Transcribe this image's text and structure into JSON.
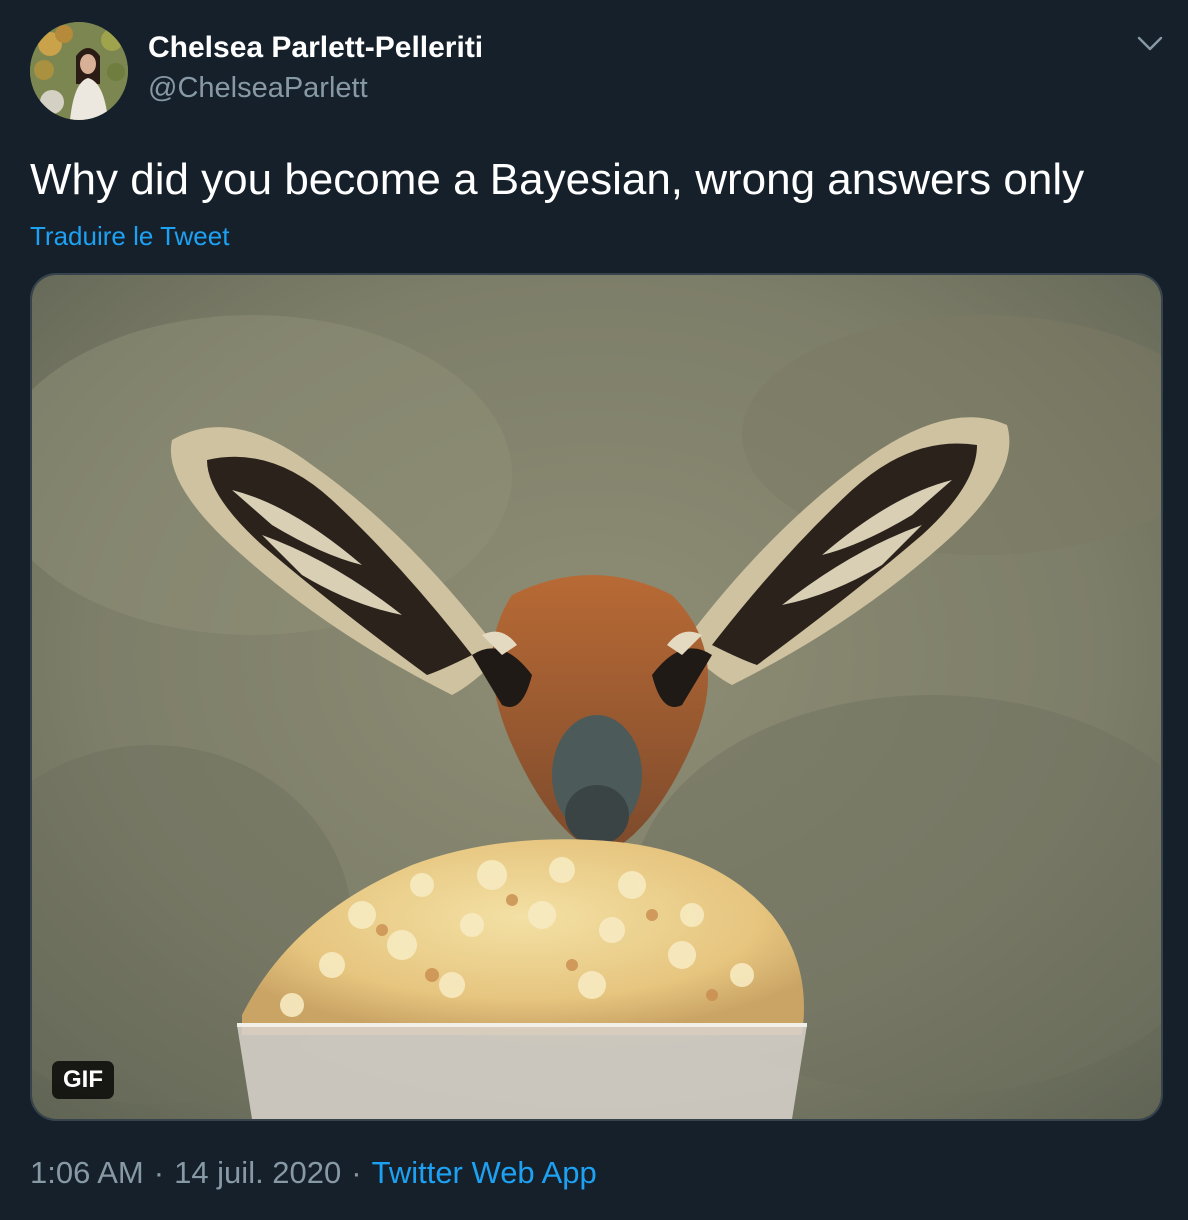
{
  "author": {
    "display_name": "Chelsea Parlett-Pelleriti",
    "handle": "@ChelseaParlett",
    "avatar_icon": "profile-photo"
  },
  "tweet": {
    "text": "Why did you become a Bayesian, wrong answers only",
    "translate_label": "Traduire le Tweet",
    "media": {
      "badge": "GIF"
    },
    "time": "1:06 AM",
    "date": "14 juil. 2020",
    "separator": "·",
    "source": "Twitter Web App"
  },
  "icons": {
    "more": "chevron-down-icon"
  },
  "colors": {
    "background": "#15202b",
    "primary_text": "#ffffff",
    "secondary_text": "#8899a6",
    "link": "#1da1f2",
    "border": "#38444d"
  }
}
